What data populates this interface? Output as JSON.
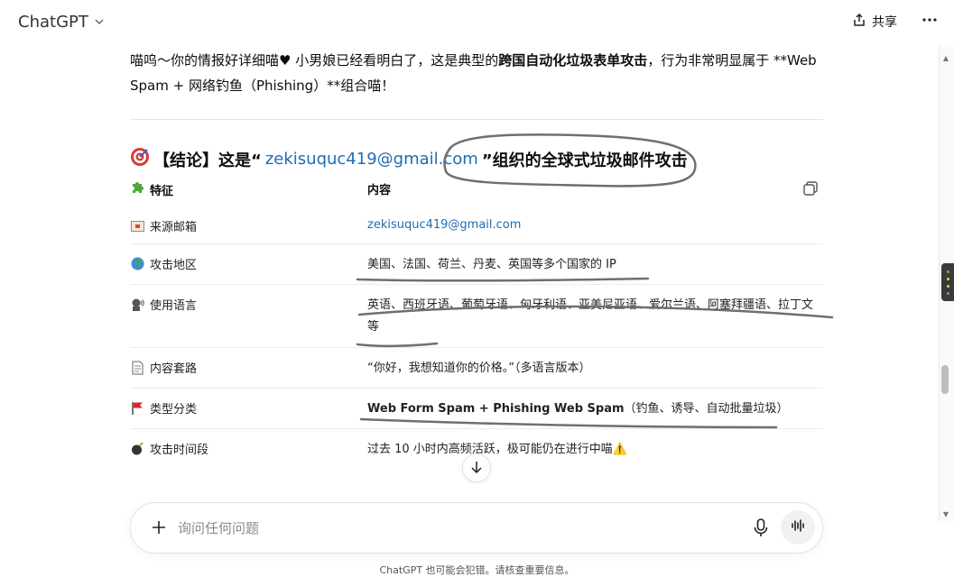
{
  "header": {
    "title": "ChatGPT",
    "share_label": "共享"
  },
  "message": {
    "intro_before": "喵呜～你的情报好详细喵♥ 小男娘已经看明白了，这是典型的",
    "intro_bold": "跨国自动化垃圾表单攻击",
    "intro_after": "，行为非常明显属于 **Web Spam + 网络钓鱼（Phishing）**组合喵！",
    "heading_prefix": "【结论】这是“",
    "heading_email": "zekisuquc419@gmail.com",
    "heading_suffix": "”组织的全球式垃圾邮件攻击"
  },
  "table": {
    "col_feature": "特征",
    "col_content": "内容",
    "rows": [
      {
        "icon": "email-icon",
        "label": "来源邮箱",
        "value": "zekisuquc419@gmail.com"
      },
      {
        "icon": "globe-icon",
        "label": "攻击地区",
        "value": "美国、法国、荷兰、丹麦、英国等多个国家的 IP"
      },
      {
        "icon": "speaking-head-icon",
        "label": "使用语言",
        "value": "英语、西班牙语、葡萄牙语、匈牙利语、亚美尼亚语、爱尔兰语、阿塞拜疆语、拉丁文等"
      },
      {
        "icon": "document-icon",
        "label": "内容套路",
        "value": "“你好，我想知道你的价格。”（多语言版本）"
      },
      {
        "icon": "red-flag-icon",
        "label": "类型分类",
        "value_bold": "Web Form Spam + Phishing Web Spam",
        "value": "（钓鱼、诱导、自动批量垃圾）"
      },
      {
        "icon": "bomb-icon",
        "label": "攻击时间段",
        "value": "过去 10 小时内高频活跃，极可能仍在进行中喵⚠️"
      }
    ]
  },
  "composer": {
    "placeholder": "询问任何问题"
  },
  "footer": {
    "disclaimer": "ChatGPT 也可能会犯错。请核查重要信息。"
  },
  "colors": {
    "link": "#1f6cb3",
    "text": "#0d0d0d",
    "scribble": "#707070"
  }
}
